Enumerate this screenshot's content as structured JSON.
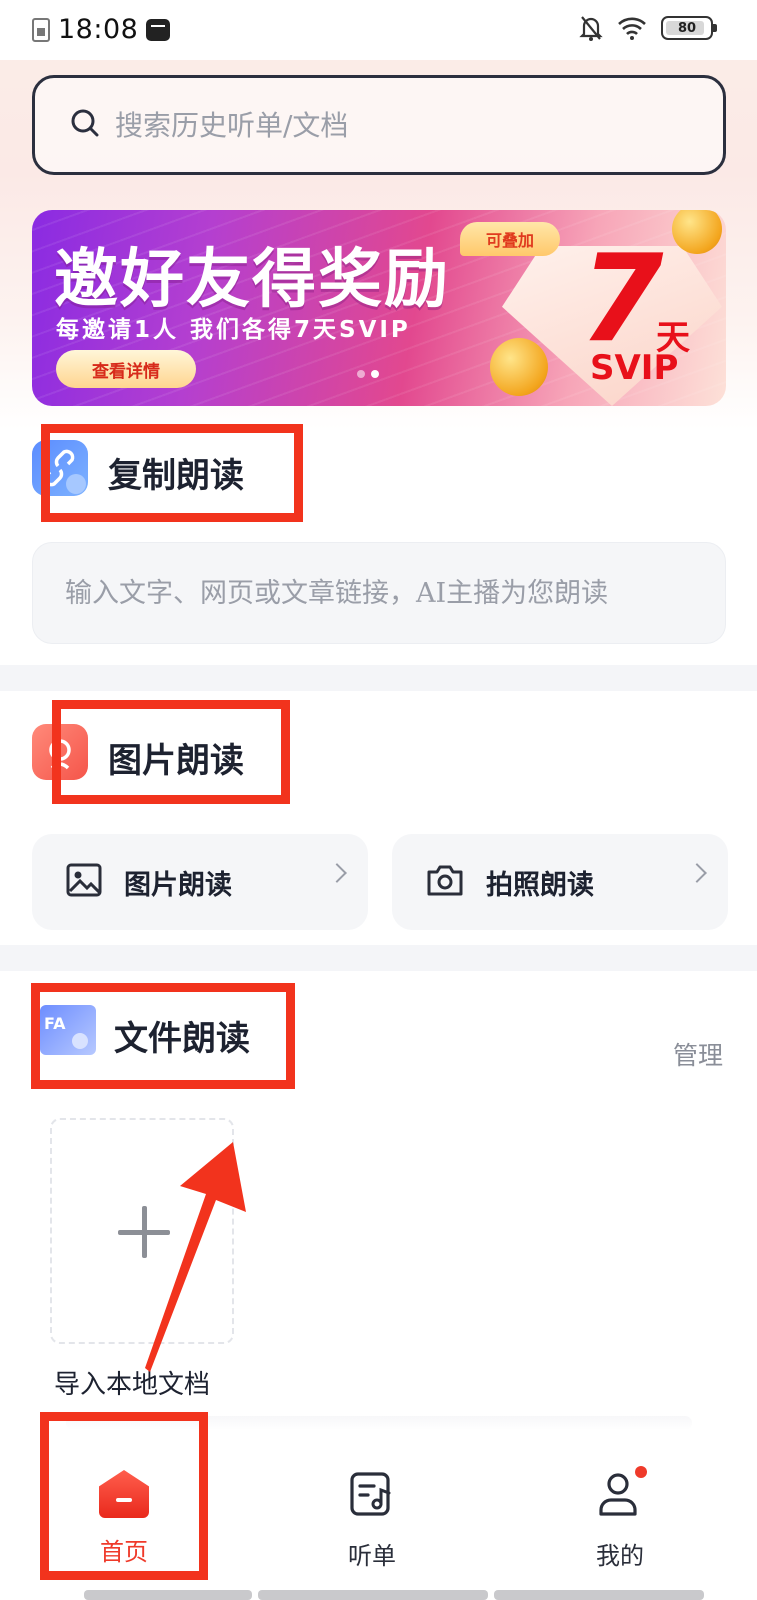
{
  "status_bar": {
    "time": "18:08",
    "battery": "80"
  },
  "search": {
    "placeholder": "搜索历史听单/文档"
  },
  "banner": {
    "title": "邀好友得奖励",
    "subtitle": "每邀请1人 我们各得7天SVIP",
    "button_label": "查看详情",
    "tag": "可叠加",
    "big_number": "7",
    "unit": "天",
    "badge": "SVIP",
    "page_count": 2,
    "active_page": 2
  },
  "sections": {
    "copy": {
      "title": "复制朗读",
      "input_placeholder": "输入文字、网页或文章链接，AI主播为您朗读"
    },
    "image": {
      "title": "图片朗读",
      "cards": [
        {
          "label": "图片朗读",
          "icon": "image-icon"
        },
        {
          "label": "拍照朗读",
          "icon": "camera-icon"
        }
      ]
    },
    "file": {
      "title": "文件朗读",
      "manage_label": "管理",
      "import_label": "导入本地文档"
    }
  },
  "bottom_nav": {
    "items": [
      {
        "label": "首页",
        "icon": "home-icon",
        "active": true
      },
      {
        "label": "听单",
        "icon": "playlist-icon",
        "active": false
      },
      {
        "label": "我的",
        "icon": "profile-icon",
        "active": false,
        "badge_dot": true
      }
    ]
  },
  "colors": {
    "accent": "#ef3a2a",
    "annotation_red": "#f2331d",
    "text_dark": "#1d2230",
    "muted": "#9a9ea8"
  }
}
